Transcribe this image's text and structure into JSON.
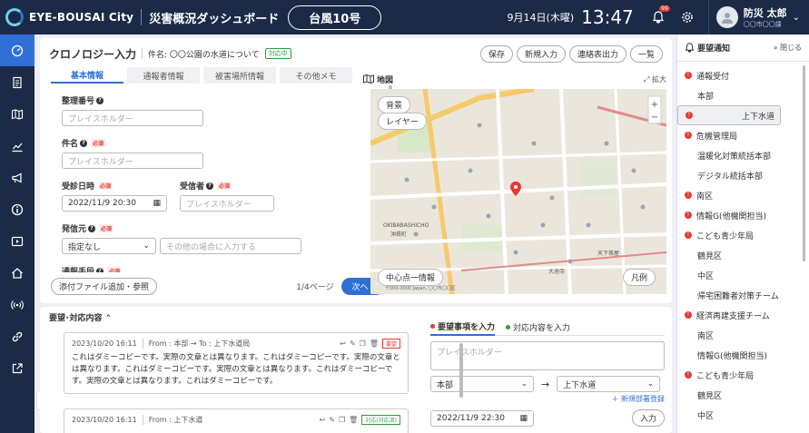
{
  "header": {
    "logo": "EYE-BOUSAI City",
    "title": "災害概況ダッシュボード",
    "disaster": "台風10号",
    "date": "9月14日(木曜)",
    "time": "13:47",
    "bell_badge": "99",
    "user_name": "防災 太郎",
    "user_sub": "〇〇市〇〇課"
  },
  "nav": {
    "icons": [
      "gauge-icon",
      "document-icon",
      "map-icon",
      "chart-icon",
      "megaphone-icon",
      "info-icon",
      "video-icon",
      "house-icon",
      "broadcast-icon",
      "link-icon",
      "external-icon"
    ],
    "expand": "›"
  },
  "chrono": {
    "title": "クロノロジー入力",
    "case_label": "件名: 〇〇公園の水道について",
    "case_badge": "対応中",
    "buttons": [
      "保存",
      "新規入力",
      "連絡表出力",
      "一覧"
    ],
    "tabs": [
      "基本情報",
      "通報者情報",
      "被害場所情報",
      "その他メモ"
    ],
    "placeholder": "プレイスホルダー",
    "required": "必須",
    "fields": {
      "number": "整理番号",
      "subject": "件名",
      "received_at": "受診日時",
      "received_value": "2022/11/9 20:30",
      "receiver": "受信者",
      "source": "発信元",
      "source_value": "指定なし",
      "source_other": "その他の場合に入力する",
      "method": "通報手段"
    },
    "attach": "添付ファイル追加・参照",
    "page": "1/4ページ",
    "next": "次へ"
  },
  "map": {
    "title": "地図",
    "expand": "拡大",
    "background_btn": "背景",
    "layer_btn": "レイヤー",
    "center_btn": "中心点一情報",
    "legend_btn": "凡例",
    "labels": {
      "okubashi": "OKIBABASHICHO",
      "okubashi_jp": "沖鉄町",
      "tengajaya": "天下茶屋",
      "oyashi": "大池寺",
      "copyright": "〒000-0000 Japan, 〇〇市〇〇区"
    }
  },
  "requests": {
    "title": "要望･対応内容",
    "cards": [
      {
        "datetime": "2023/10/20 16:11",
        "route": "From : 本部 → To : 上下水道局",
        "badge": "要望",
        "body": "これはダミーコピーです。実際の文章とは異なります。これはダミーコピーです。実際の文章とは異なります。これはダミーコピーです。実際の文章とは異なります。これはダミーコピーです。実際の文章とは異なります。これはダミーコピーです。"
      },
      {
        "datetime": "2023/10/20 16:11",
        "route": "From : 上下水道",
        "badge": "対応(対応済)",
        "body": ""
      }
    ],
    "form": {
      "tab_request": "要望事項を入力",
      "tab_response": "対応内容を入力",
      "placeholder": "プレイスホルダー",
      "from": "本部",
      "to": "上下水道",
      "new_dept": "＋ 新規部署登録",
      "datetime": "2022/11/9 22:30",
      "submit": "入力"
    }
  },
  "notif": {
    "title": "要望通知",
    "close": "閉じる",
    "items": [
      {
        "label": "通報受付",
        "dot": true,
        "sub": false,
        "selected": false
      },
      {
        "label": "本部",
        "dot": false,
        "sub": true,
        "selected": false
      },
      {
        "label": "上下水道",
        "dot": true,
        "sub": false,
        "selected": true
      },
      {
        "label": "危機管理局",
        "dot": true,
        "sub": false,
        "selected": false
      },
      {
        "label": "温暖化対策統括本部",
        "dot": false,
        "sub": true,
        "selected": false
      },
      {
        "label": "デジタル統括本部",
        "dot": false,
        "sub": true,
        "selected": false
      },
      {
        "label": "南区",
        "dot": true,
        "sub": false,
        "selected": false
      },
      {
        "label": "情報G(他機関担当)",
        "dot": true,
        "sub": false,
        "selected": false
      },
      {
        "label": "こども青少年局",
        "dot": true,
        "sub": false,
        "selected": false
      },
      {
        "label": "鶴見区",
        "dot": false,
        "sub": true,
        "selected": false
      },
      {
        "label": "中区",
        "dot": false,
        "sub": true,
        "selected": false
      },
      {
        "label": "帰宅困難者対策チーム",
        "dot": false,
        "sub": true,
        "selected": false
      },
      {
        "label": "経済再建支援チーム",
        "dot": true,
        "sub": false,
        "selected": false
      },
      {
        "label": "南区",
        "dot": false,
        "sub": true,
        "selected": false
      },
      {
        "label": "情報G(他機関担当)",
        "dot": false,
        "sub": true,
        "selected": false
      },
      {
        "label": "こども青少年局",
        "dot": true,
        "sub": false,
        "selected": false
      },
      {
        "label": "鶴見区",
        "dot": false,
        "sub": true,
        "selected": false
      },
      {
        "label": "中区",
        "dot": false,
        "sub": true,
        "selected": false
      }
    ]
  },
  "colors": {
    "navy": "#1a2a47",
    "accent": "#2f6fd6",
    "required": "#e53935",
    "status_green": "#2e9c3f"
  }
}
